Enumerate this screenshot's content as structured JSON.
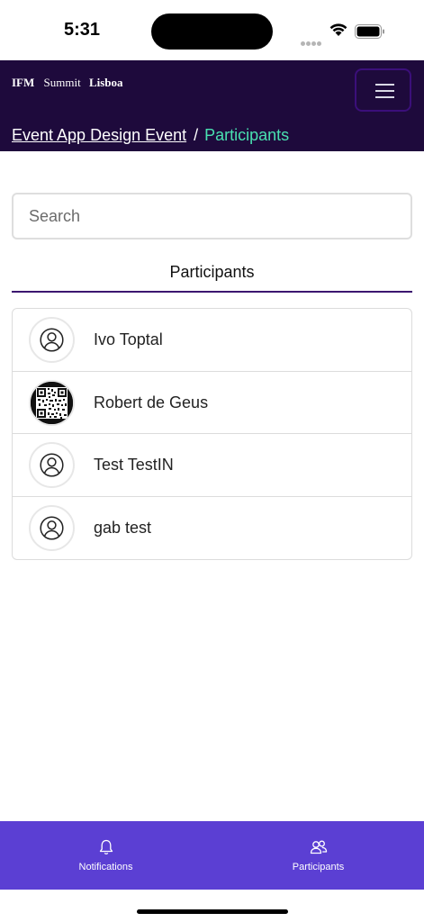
{
  "status_bar": {
    "time": "5:31"
  },
  "header": {
    "brand_part1": "IFM",
    "brand_part2": "Summit",
    "brand_part3": "Lisboa",
    "background_color": "#1e0a3c",
    "menu_icon": "hamburger-icon"
  },
  "breadcrumb": {
    "parent": "Event App Design Event",
    "separator": "/",
    "current": "Participants",
    "current_color": "#49e0b0"
  },
  "search": {
    "placeholder": "Search",
    "value": ""
  },
  "tabs": {
    "active_label": "Participants"
  },
  "participants": [
    {
      "name": "Ivo Toptal",
      "avatar": "user-icon"
    },
    {
      "name": "Robert de Geus",
      "avatar": "qr-code-image"
    },
    {
      "name": "Test TestIN",
      "avatar": "user-icon"
    },
    {
      "name": "gab test",
      "avatar": "user-icon"
    }
  ],
  "bottom_nav": {
    "background_color": "#5b3fd3",
    "items": [
      {
        "label": "Notifications",
        "icon": "bell-icon"
      },
      {
        "label": "Participants",
        "icon": "people-icon"
      }
    ]
  }
}
